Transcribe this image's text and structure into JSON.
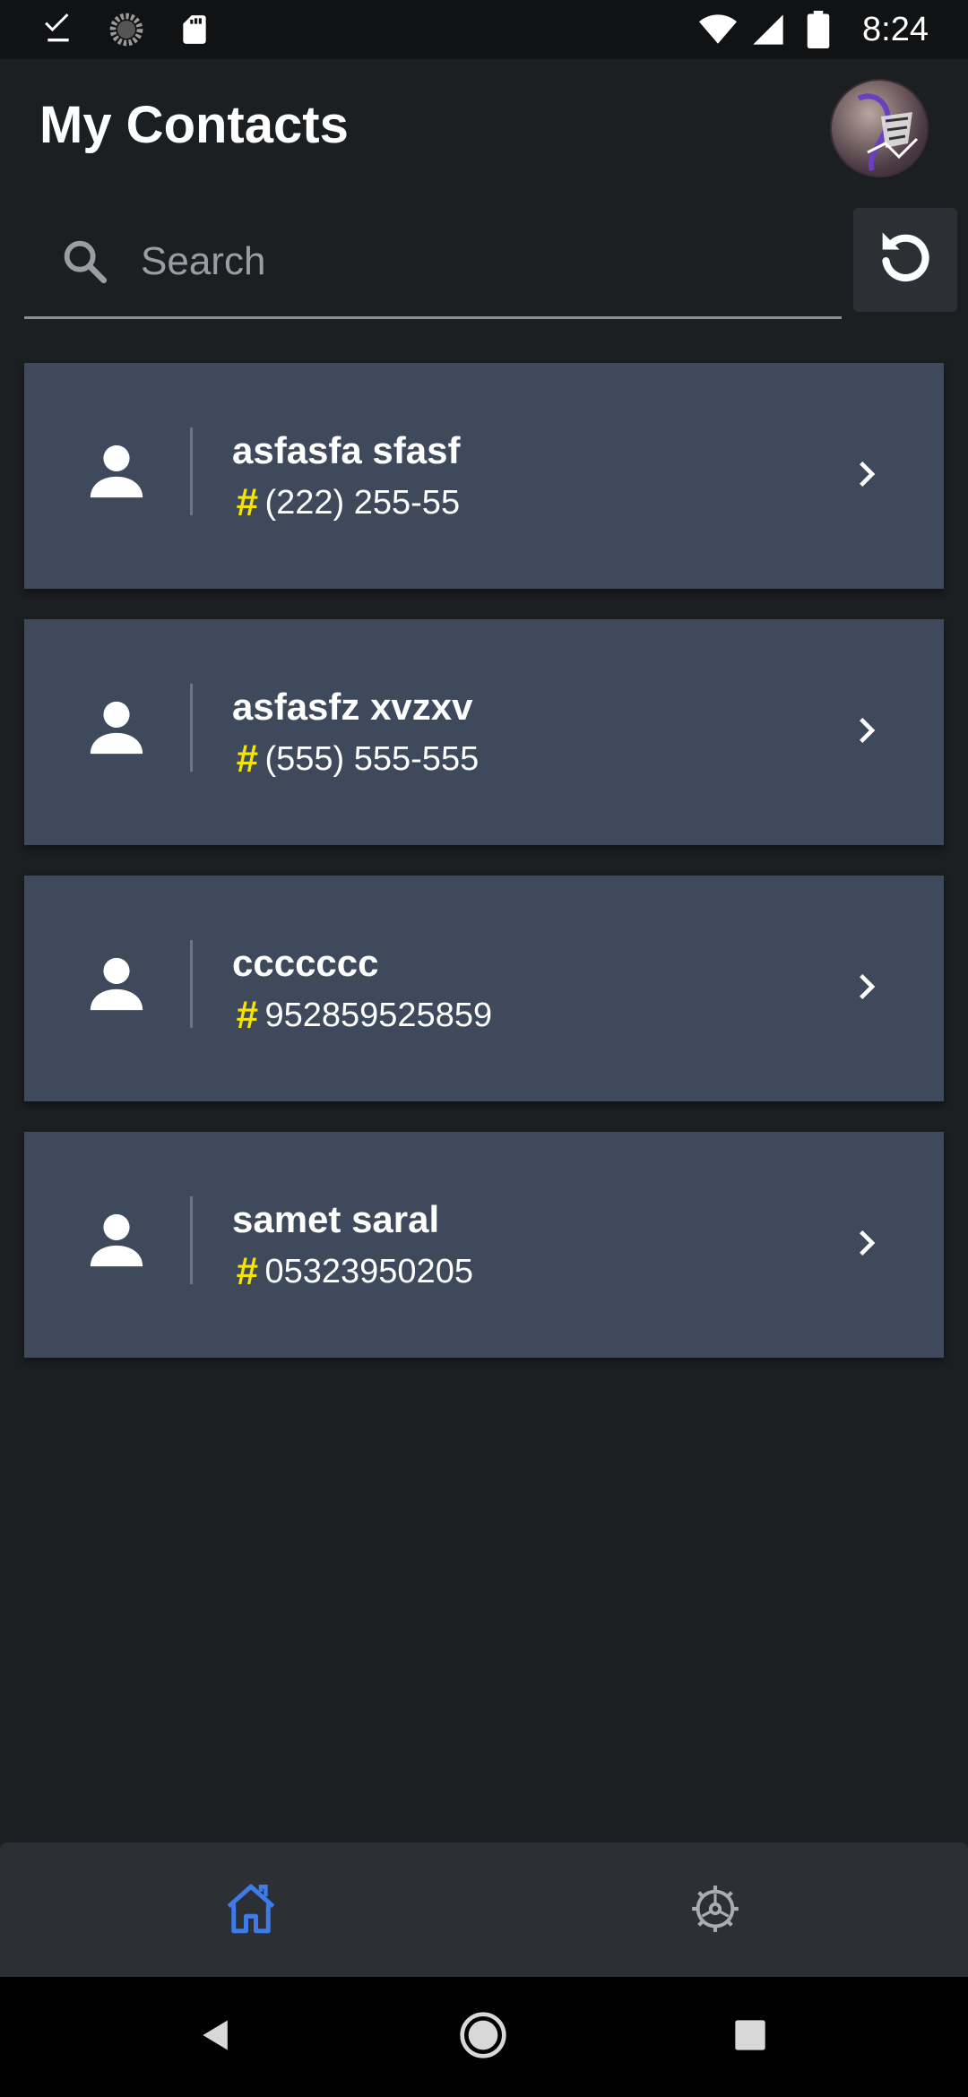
{
  "status_bar": {
    "time": "8:24",
    "left_icons": [
      "download-done-icon",
      "loading-icon",
      "sd-card-icon"
    ],
    "right_icons": [
      "wifi-icon",
      "cell-signal-icon",
      "battery-icon"
    ]
  },
  "header": {
    "title": "My Contacts"
  },
  "search": {
    "placeholder": "Search",
    "value": ""
  },
  "contacts": [
    {
      "name": "asfasfa sfasf",
      "phone": "(222) 255-55"
    },
    {
      "name": "asfasfz xvzxv",
      "phone": "(555) 555-555"
    },
    {
      "name": "ccccccc",
      "phone": "952859525859"
    },
    {
      "name": "samet saral",
      "phone": "05323950205"
    }
  ],
  "contact_hash_symbol": "#",
  "bottom_nav": {
    "items": [
      {
        "id": "home",
        "icon": "home-icon",
        "active": true
      },
      {
        "id": "settings",
        "icon": "settings-icon",
        "active": false
      }
    ]
  },
  "colors": {
    "background": "#1c1f22",
    "card": "#3e4a5c",
    "accent_hash": "#f5e400",
    "active_nav": "#3f7be8",
    "inactive_nav": "#a8adb3"
  }
}
